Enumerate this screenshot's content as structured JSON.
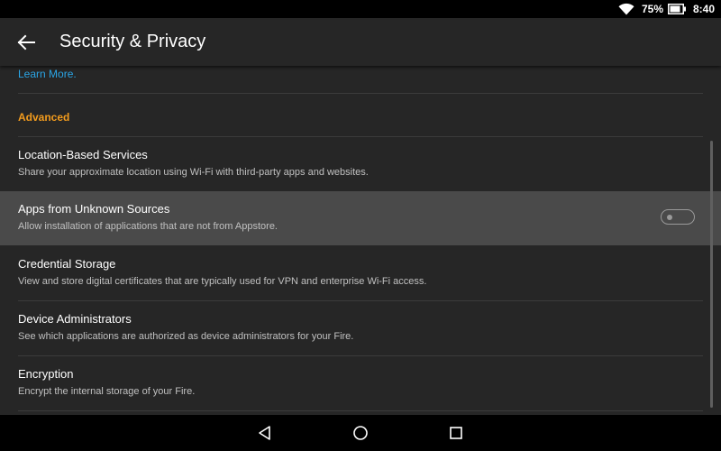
{
  "status_bar": {
    "battery_percent": "75%",
    "time": "8:40",
    "icons": [
      "wifi-icon",
      "battery-icon"
    ]
  },
  "app_bar": {
    "title": "Security & Privacy",
    "back_icon": "arrow-left-icon"
  },
  "content": {
    "learn_more": "Learn More.",
    "section_header": "Advanced",
    "items": [
      {
        "title": "Location-Based Services",
        "subtitle": "Share your approximate location using Wi-Fi with third-party apps and websites."
      },
      {
        "title": "Apps from Unknown Sources",
        "subtitle": "Allow installation of applications that are not from Appstore.",
        "toggle": "off"
      },
      {
        "title": "Credential Storage",
        "subtitle": "View and store digital certificates that are typically used for VPN and enterprise Wi-Fi access."
      },
      {
        "title": "Device Administrators",
        "subtitle": "See which applications are authorized as device administrators for your Fire."
      },
      {
        "title": "Encryption",
        "subtitle": "Encrypt the internal storage of your Fire."
      }
    ]
  },
  "nav_bar": {
    "icons": [
      "back-triangle-icon",
      "home-circle-icon",
      "recents-square-icon"
    ]
  },
  "colors": {
    "accent_link": "#2aa5e6",
    "section_header": "#f29b1d",
    "background": "#262626",
    "highlight_row": "#4a4a4a"
  }
}
